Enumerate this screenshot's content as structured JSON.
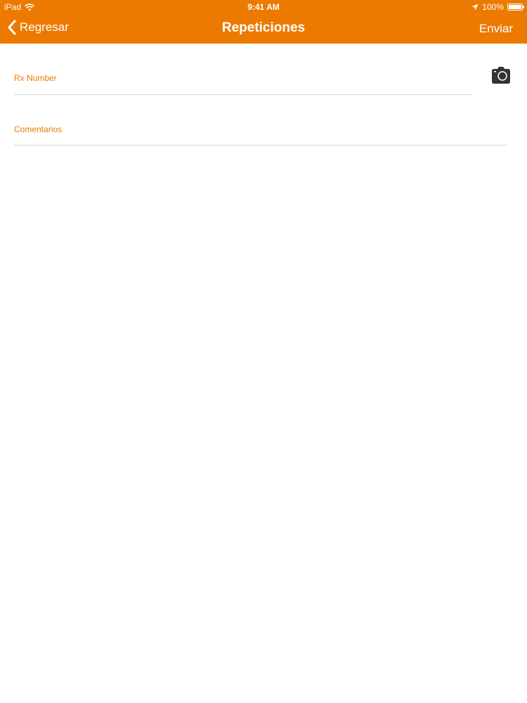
{
  "colors": {
    "accent": "#EC7A00",
    "background": "#FFFFFF",
    "divider": "#D6D6D6",
    "icon": "#333333"
  },
  "status_bar": {
    "device": "iPad",
    "time": "9:41 AM",
    "battery_text": "100%",
    "battery_level": 1.0,
    "icons": [
      "wifi-icon",
      "location-arrow-icon",
      "battery-icon"
    ]
  },
  "navbar": {
    "back_label": "Regresar",
    "title": "Repeticiones",
    "send_label": "Enviar",
    "icons": [
      "chevron-left-icon"
    ]
  },
  "form": {
    "rx_number": {
      "label": "Rx Number",
      "value": "",
      "icon": "camera-icon"
    },
    "comments": {
      "label": "Comentarios",
      "value": ""
    }
  }
}
